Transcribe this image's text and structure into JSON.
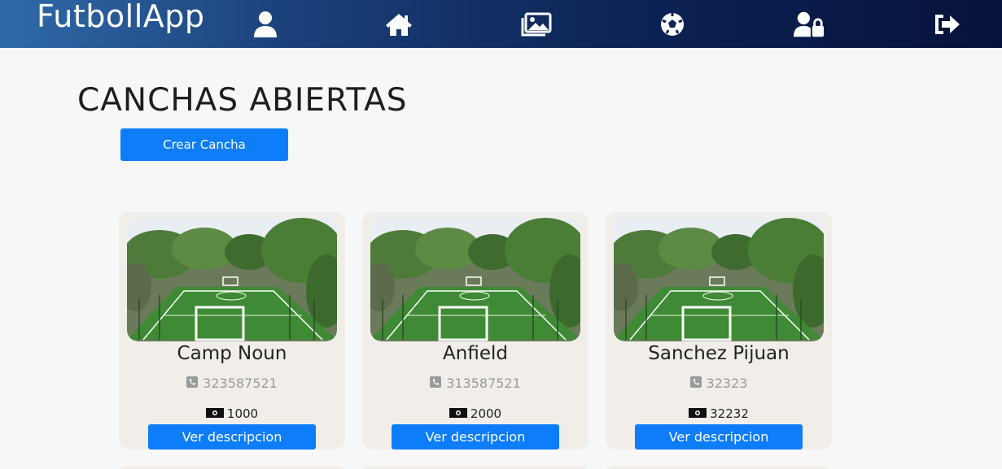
{
  "app": {
    "brand": "FutbollApp"
  },
  "nav": {
    "icons": [
      "user-icon",
      "home-icon",
      "gallery-icon",
      "soccer-ball-icon",
      "user-lock-icon",
      "sign-out-icon"
    ]
  },
  "page": {
    "title": "CANCHAS ABIERTAS",
    "create_label": "Crear Cancha"
  },
  "cards": [
    {
      "name": "Camp Noun",
      "phone": "323587521",
      "price": "1000",
      "button": "Ver descripcion"
    },
    {
      "name": "Anfield",
      "phone": "313587521",
      "price": "2000",
      "button": "Ver descripcion"
    },
    {
      "name": "Sanchez Pijuan",
      "phone": "32323",
      "price": "32232",
      "button": "Ver descripcion"
    }
  ],
  "colors": {
    "nav_start": "#2f6aa8",
    "nav_end": "#06123a",
    "primary_button": "#0d7dfa",
    "card_bg": "#f1eeea"
  }
}
